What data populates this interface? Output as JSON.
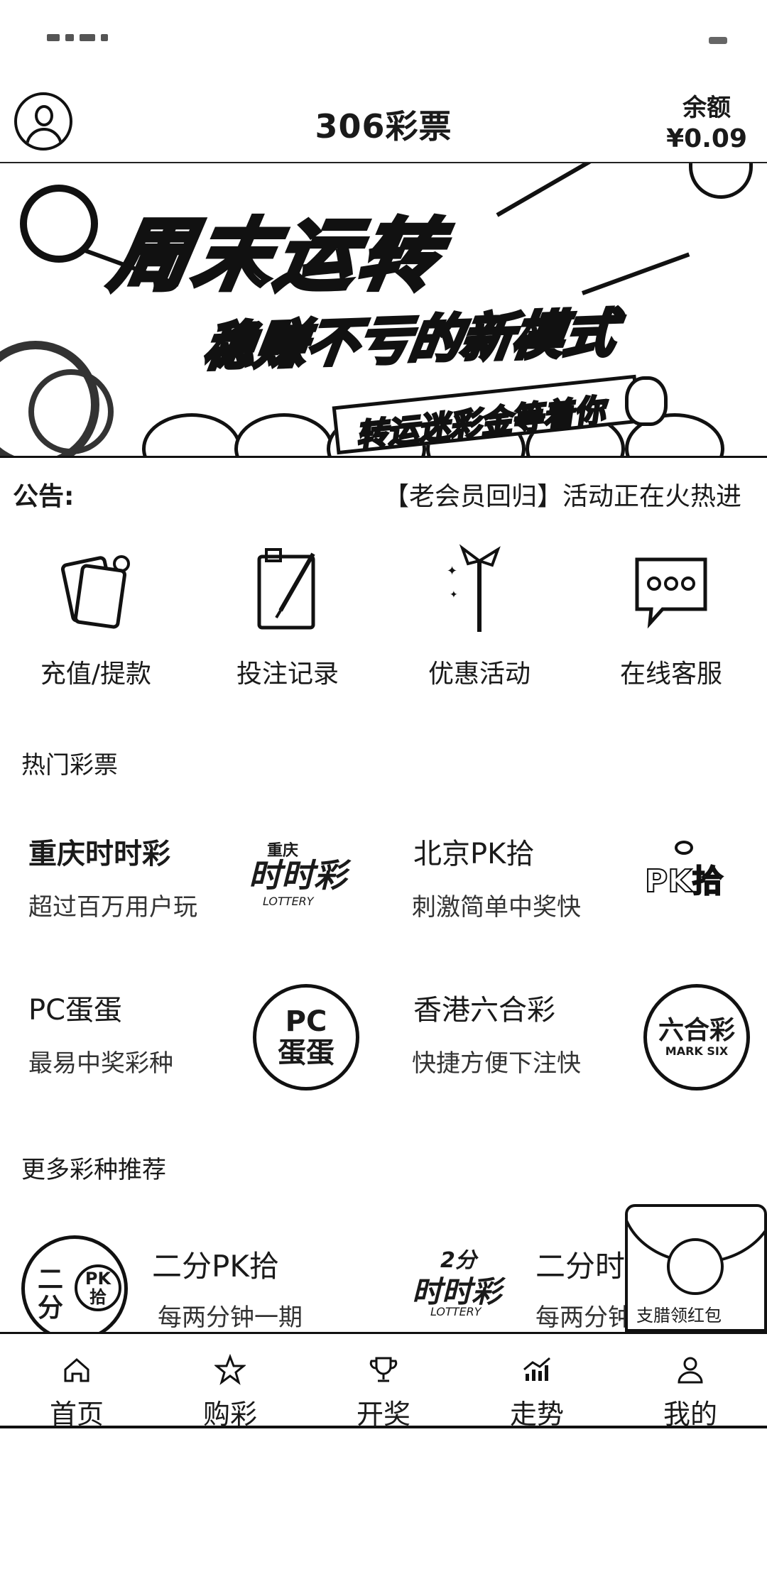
{
  "header": {
    "title": "306彩票",
    "balance_label": "余额",
    "balance_amount": "¥0.09"
  },
  "banner": {
    "headline": "周末运转",
    "subline": "稳赚不亏的新模式",
    "ribbon_text": "转运迷彩金等着你"
  },
  "notice": {
    "label": "公告:",
    "text": "【老会员回归】活动正在火热进"
  },
  "quick_menu": [
    {
      "label": "充值/提款",
      "icon": "wallet-icon"
    },
    {
      "label": "投注记录",
      "icon": "clipboard-icon"
    },
    {
      "label": "优惠活动",
      "icon": "gift-icon"
    },
    {
      "label": "在线客服",
      "icon": "chat-icon"
    }
  ],
  "hot_section": {
    "title": "热门彩票",
    "items": [
      {
        "name": "重庆时时彩",
        "desc": "超过百万用户玩",
        "logo_top": "重庆",
        "logo_main": "时时彩",
        "logo_sub": "LOTTERY"
      },
      {
        "name": "北京PK拾",
        "desc": "刺激简单中奖快",
        "logo_main": "PK拾"
      },
      {
        "name": "PC蛋蛋",
        "desc": "最易中奖彩种",
        "logo_top": "PC",
        "logo_main": "蛋蛋"
      },
      {
        "name": "香港六合彩",
        "desc": "快捷方便下注快",
        "logo_main": "六合彩",
        "logo_sub": "MARK SIX"
      }
    ]
  },
  "more_section": {
    "title": "更多彩种推荐",
    "items": [
      {
        "name": "二分PK拾",
        "desc": "每两分钟一期",
        "logo_left": "二分",
        "logo_right": "PK拾"
      },
      {
        "name": "二分时",
        "desc": "每两分钟",
        "logo_top": "2分",
        "logo_main": "时时彩",
        "logo_sub": "LOTTERY"
      }
    ]
  },
  "red_packet": {
    "caption": "支腊领红包"
  },
  "tabbar": [
    {
      "label": "首页",
      "icon": "home-icon"
    },
    {
      "label": "购彩",
      "icon": "star-icon"
    },
    {
      "label": "开奖",
      "icon": "trophy-icon"
    },
    {
      "label": "走势",
      "icon": "trend-icon"
    },
    {
      "label": "我的",
      "icon": "user-icon"
    }
  ]
}
